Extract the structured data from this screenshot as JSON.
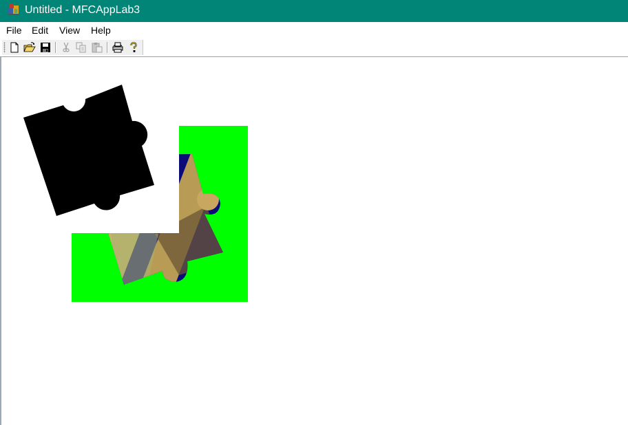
{
  "window": {
    "title": "Untitled - MFCAppLab3",
    "titlebar_color": "#008577",
    "app_icon": "mfc-app-icon"
  },
  "menu": {
    "items": [
      {
        "label": "File"
      },
      {
        "label": "Edit"
      },
      {
        "label": "View"
      },
      {
        "label": "Help"
      }
    ]
  },
  "toolbar": {
    "buttons": [
      {
        "icon": "new-document-icon",
        "enabled": true
      },
      {
        "icon": "open-folder-icon",
        "enabled": true
      },
      {
        "icon": "save-disk-icon",
        "enabled": true
      },
      {
        "icon": "cut-scissors-icon",
        "enabled": false
      },
      {
        "icon": "copy-icon",
        "enabled": false
      },
      {
        "icon": "paste-clipboard-icon",
        "enabled": false
      },
      {
        "icon": "print-icon",
        "enabled": true
      },
      {
        "icon": "help-question-icon",
        "enabled": true
      }
    ]
  },
  "canvas": {
    "background": "#ffffff",
    "green_mask_color": "#00ff00",
    "black_piece_color": "#000000",
    "stripe_colors": [
      "#0a0a78",
      "#c8b060",
      "#8a7a50"
    ]
  }
}
